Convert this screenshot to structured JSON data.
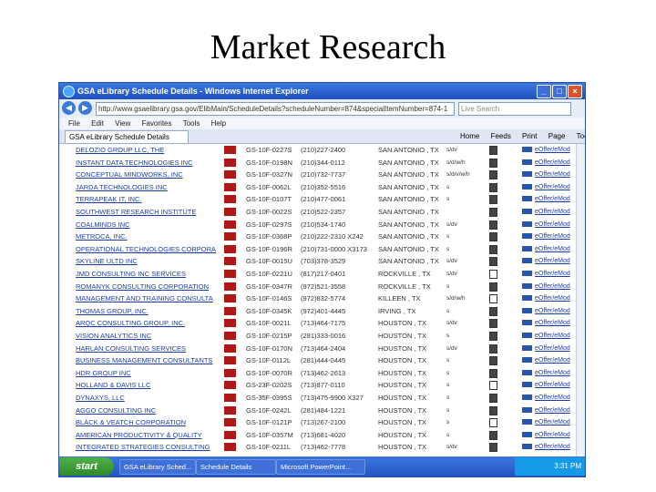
{
  "slide": {
    "title": "Market Research"
  },
  "browser": {
    "window_title": "GSA eLibrary Schedule Details - Windows Internet Explorer",
    "address": "http://www.gsaelibrary.gsa.gov/ElibMain/ScheduleDetails?scheduleNumber=874&specialItemNumber=874-1",
    "search_placeholder": "Live Search",
    "menu_items": [
      "File",
      "Edit",
      "View",
      "Favorites",
      "Tools",
      "Help"
    ],
    "tab_label": "GSA eLibrary Schedule Details",
    "toolbar_items": [
      "Home",
      "Feeds",
      "Print",
      "Page",
      "Tools"
    ]
  },
  "table": {
    "rows": [
      {
        "name": "DELOZIO GROUP LLC, THE",
        "contract": "GS-10F-0227S",
        "phone": "(210)227-2400",
        "city": "SAN ANTONIO , TX",
        "extra": "s/dv",
        "doc_filled": true,
        "link": "eOffer/eMod"
      },
      {
        "name": "INSTANT DATA TECHNOLOGIES INC",
        "contract": "GS-10F-0198N",
        "phone": "(210)344-0112",
        "city": "SAN ANTONIO , TX",
        "extra": "s/d/w/h",
        "doc_filled": true,
        "link": "eOffer/eMod"
      },
      {
        "name": "CONCEPTUAL MINDWORKS, INC",
        "contract": "GS-10F-0327N",
        "phone": "(210)732-7737",
        "city": "SAN ANTONIO , TX",
        "extra": "s/d/v/w/h",
        "doc_filled": true,
        "link": "eOffer/eMod"
      },
      {
        "name": "JARDA TECHNOLOGIES INC",
        "contract": "GS-10F-0062L",
        "phone": "(210)352-5516",
        "city": "SAN ANTONIO , TX",
        "extra": "s",
        "doc_filled": true,
        "link": "eOffer/eMod"
      },
      {
        "name": "TERRAPEAK IT, INC.",
        "contract": "GS-10F-0107T",
        "phone": "(210)477-0061",
        "city": "SAN ANTONIO , TX",
        "extra": "s",
        "doc_filled": true,
        "link": "eOffer/eMod"
      },
      {
        "name": "SOUTHWEST RESEARCH INSTITUTE",
        "contract": "GS-10F-0022S",
        "phone": "(210)522-2357",
        "city": "SAN ANTONIO , TX",
        "extra": "",
        "doc_filled": true,
        "link": "eOffer/eMod"
      },
      {
        "name": "COALMINDS INC",
        "contract": "GS-10F-0297S",
        "phone": "(210)534-1740",
        "city": "SAN ANTONIO , TX",
        "extra": "s/dv",
        "doc_filled": true,
        "link": "eOffer/eMod"
      },
      {
        "name": "METROCA, INC.",
        "contract": "GS-10F-0368P",
        "phone": "(210)222-2310 X242",
        "city": "SAN ANTONIO , TX",
        "extra": "s",
        "doc_filled": true,
        "link": "eOffer/eMod"
      },
      {
        "name": "OPERATIONAL TECHNOLOGIES CORPORA",
        "contract": "GS-10F-0196R",
        "phone": "(210)731-0000 X3173",
        "city": "SAN ANTONIO , TX",
        "extra": "s",
        "doc_filled": true,
        "link": "eOffer/eMod"
      },
      {
        "name": "SKYLINE ULTD INC",
        "contract": "GS-10F-0015U",
        "phone": "(703)378-3529",
        "city": "SAN ANTONIO , TX",
        "extra": "s/dv",
        "doc_filled": true,
        "link": "eOffer/eMod"
      },
      {
        "name": "JMD CONSULTING INC SERVICES",
        "contract": "GS-10F-0221U",
        "phone": "(817)217-0401",
        "city": "ROCKVILLE , TX",
        "extra": "s/dv",
        "doc_filled": false,
        "link": "eOffer/eMod"
      },
      {
        "name": "ROMANYK CONSULTING CORPORATION",
        "contract": "GS-10F-0347R",
        "phone": "(972)521-3558",
        "city": "ROCKVILLE , TX",
        "extra": "s",
        "doc_filled": true,
        "link": "eOffer/eMod"
      },
      {
        "name": "MANAGEMENT AND TRAINING CONSULTA",
        "contract": "GS-10F-0146S",
        "phone": "(972)832-5774",
        "city": "KILLEEN , TX",
        "extra": "s/d/w/h",
        "doc_filled": false,
        "link": "eOffer/eMod"
      },
      {
        "name": "THOMAS GROUP, INC.",
        "contract": "GS-10F-0345K",
        "phone": "(972)401-4445",
        "city": "IRVING , TX",
        "extra": "s",
        "doc_filled": true,
        "link": "eOffer/eMod"
      },
      {
        "name": "ARQC CONSULTING GROUP, INC.",
        "contract": "GS-10F-0021L",
        "phone": "(713)464-7175",
        "city": "HOUSTON , TX",
        "extra": "s/dv",
        "doc_filled": true,
        "link": "eOffer/eMod"
      },
      {
        "name": "VISION ANALYTICS INC",
        "contract": "GS-10F-0215P",
        "phone": "(281)333-0016",
        "city": "HOUSTON , TX",
        "extra": "s",
        "doc_filled": true,
        "link": "eOffer/eMod"
      },
      {
        "name": "HARLAN CONSULTING SERVICES",
        "contract": "GS-10F-0170N",
        "phone": "(713)464-2404",
        "city": "HOUSTON , TX",
        "extra": "s/dv",
        "doc_filled": true,
        "link": "eOffer/eMod"
      },
      {
        "name": "BUSINESS MANAGEMENT CONSULTANTS",
        "contract": "GS-10F-0112L",
        "phone": "(281)444-0445",
        "city": "HOUSTON , TX",
        "extra": "s",
        "doc_filled": true,
        "link": "eOffer/eMod"
      },
      {
        "name": "HDR GROUP INC",
        "contract": "GS-10F-0070R",
        "phone": "(713)462-2613",
        "city": "HOUSTON , TX",
        "extra": "s",
        "doc_filled": true,
        "link": "eOffer/eMod"
      },
      {
        "name": "HOLLAND & DAVIS LLC",
        "contract": "GS-23F-0202S",
        "phone": "(713)877-0110",
        "city": "HOUSTON , TX",
        "extra": "s",
        "doc_filled": false,
        "link": "eOffer/eMod"
      },
      {
        "name": "DYNAXYS, LLC",
        "contract": "GS-35F-0395S",
        "phone": "(713)475-9900 X327",
        "city": "HOUSTON , TX",
        "extra": "s",
        "doc_filled": true,
        "link": "eOffer/eMod"
      },
      {
        "name": "AGGO CONSULTING INC",
        "contract": "GS-10F-0242L",
        "phone": "(281)484-1221",
        "city": "HOUSTON , TX",
        "extra": "s",
        "doc_filled": true,
        "link": "eOffer/eMod"
      },
      {
        "name": "BLACK & VEATCH CORPORATION",
        "contract": "GS-10F-0121P",
        "phone": "(713)267-2100",
        "city": "HOUSTON , TX",
        "extra": "s",
        "doc_filled": false,
        "link": "eOffer/eMod"
      },
      {
        "name": "AMERICAN PRODUCTIVITY & QUALITY",
        "contract": "GS-10F-0357M",
        "phone": "(713)681-4020",
        "city": "HOUSTON , TX",
        "extra": "s",
        "doc_filled": true,
        "link": "eOffer/eMod"
      },
      {
        "name": "INTEGRATED STRATEGIES CONSULTING",
        "contract": "GS-10F-0211L",
        "phone": "(713)462-7778",
        "city": "HOUSTON , TX",
        "extra": "s/dv",
        "doc_filled": true,
        "link": "eOffer/eMod"
      }
    ]
  },
  "taskbar": {
    "start_label": "start",
    "tasks": [
      "GSA eLibrary Sched...",
      "Schedule Details",
      "Microsoft PowerPoint..."
    ],
    "clock": "3:31 PM"
  }
}
